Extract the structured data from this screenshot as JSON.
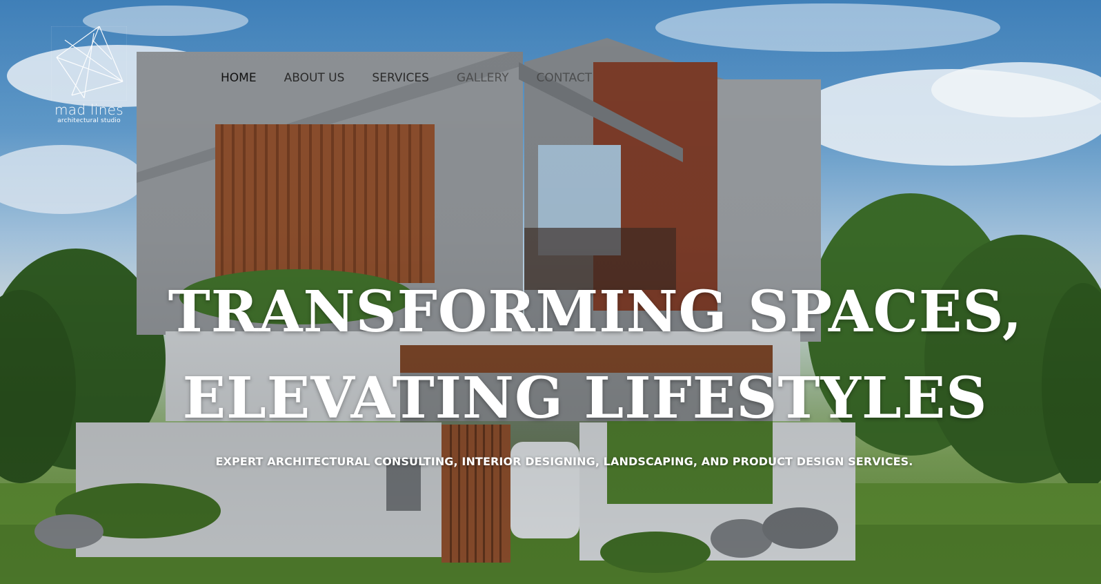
{
  "brand": {
    "name": "mad lines",
    "subtitle": "architectural studio"
  },
  "nav": {
    "items": [
      {
        "label": "HOME"
      },
      {
        "label": "ABOUT US"
      },
      {
        "label": "SERVICES"
      },
      {
        "label": "GALLERY"
      },
      {
        "label": "CONTACT"
      }
    ],
    "active": "HOME"
  },
  "hero": {
    "headline_line1": "TRANSFORMING SPACES,",
    "headline_line2": "ELEVATING LIFESTYLES",
    "tagline": "EXPERT ARCHITECTURAL CONSULTING, INTERIOR DESIGNING, LANDSCAPING, AND PRODUCT DESIGN SERVICES."
  },
  "colors": {
    "sky": "#5f99c9",
    "concrete": "#8e9296",
    "brick": "#7a3b28",
    "wood": "#9a5a34",
    "grass": "#5d8a34",
    "text": "#ffffff",
    "nav_text": "#2b2b2b"
  }
}
